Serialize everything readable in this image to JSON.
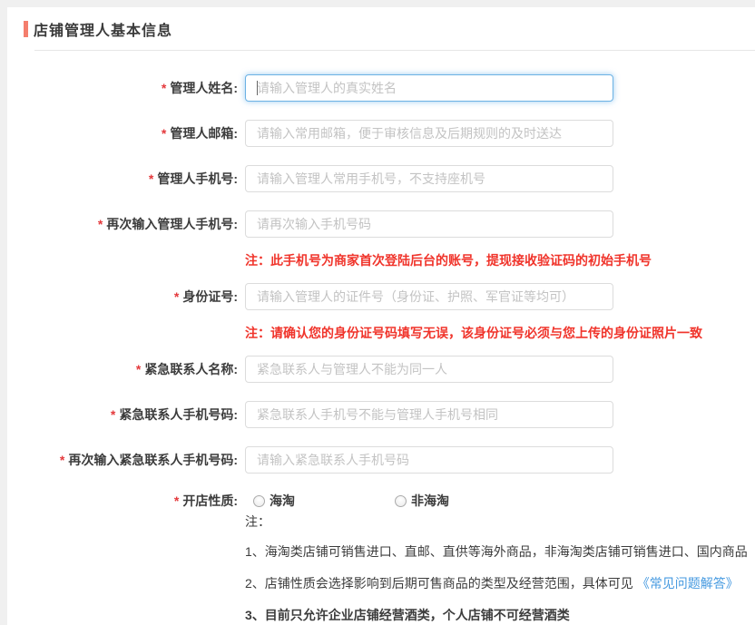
{
  "header": {
    "title": "店铺管理人基本信息"
  },
  "form": {
    "required_marker": "*",
    "fields": [
      {
        "label": "管理人姓名:",
        "placeholder": "请输入管理人的真实姓名"
      },
      {
        "label": "管理人邮箱:",
        "placeholder": "请输入常用邮箱，便于审核信息及后期规则的及时送达"
      },
      {
        "label": "管理人手机号:",
        "placeholder": "请输入管理人常用手机号，不支持座机号"
      },
      {
        "label": "再次输入管理人手机号:",
        "placeholder": "请再次输入手机号码",
        "note": "注：此手机号为商家首次登陆后台的账号，提现接收验证码的初始手机号"
      },
      {
        "label": "身份证号:",
        "placeholder": "请输入管理人的证件号（身份证、护照、军官证等均可）",
        "note": "注：请确认您的身份证号码填写无误，该身份证号必须与您上传的身份证照片一致"
      },
      {
        "label": "紧急联系人名称:",
        "placeholder": "紧急联系人与管理人不能为同一人"
      },
      {
        "label": "紧急联系人手机号码:",
        "placeholder": "紧急联系人手机号不能与管理人手机号相同"
      },
      {
        "label": "再次输入紧急联系人手机号码:",
        "placeholder": "请输入紧急联系人手机号码"
      }
    ],
    "shop_type": {
      "label": "开店性质:",
      "options": [
        {
          "label": "海淘",
          "checked": false
        },
        {
          "label": "非海淘",
          "checked": false
        }
      ]
    },
    "notes_heading": "注：",
    "notes": [
      {
        "text": "1、海淘类店铺可销售进口、直邮、直供等海外商品，非海淘类店铺可销售进口、国内商品"
      },
      {
        "text": "2、店铺性质会选择影响到后期可售商品的类型及经营范围，具体可见",
        "link": "《常见问题解答》"
      },
      {
        "text": "3、目前只允许企业店铺经营酒类，个人店铺不可经营酒类"
      }
    ]
  },
  "colors": {
    "accent_bar": "#f47e6d",
    "required_star": "#e4393c",
    "note_red": "#f0342b",
    "link_blue": "#4499e0",
    "focus_blue": "#6cb2e4",
    "page_background": "#f0f0f0"
  }
}
